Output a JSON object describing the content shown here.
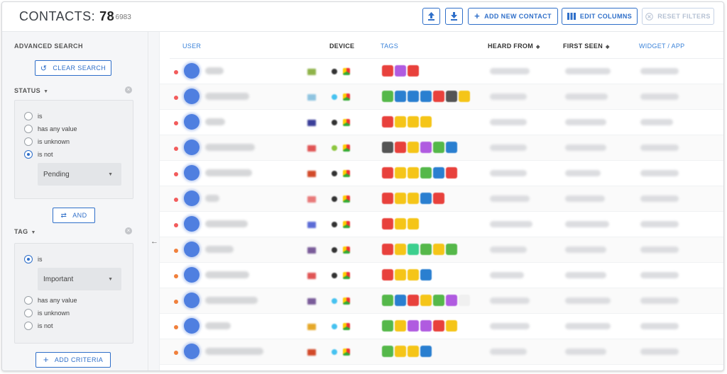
{
  "header": {
    "title": "CONTACTS:",
    "count": "78",
    "total": "/ 6983",
    "upload_icon": "upload-icon",
    "download_icon": "download-icon",
    "add_contact_label": "ADD NEW CONTACT",
    "edit_columns_label": "EDIT COLUMNS",
    "reset_filters_label": "RESET FILTERS",
    "accent_color": "#2f6fc9"
  },
  "sidebar": {
    "heading": "ADVANCED SEARCH",
    "clear_search_label": "CLEAR SEARCH",
    "collapse_icon": "←",
    "status_filter": {
      "label": "STATUS",
      "options": [
        "is",
        "has any value",
        "is unknown",
        "is not"
      ],
      "selected": "is not",
      "value": "Pending"
    },
    "and_label": "AND",
    "tag_filter": {
      "label": "TAG",
      "options": [
        "is",
        "has any value",
        "is unknown",
        "is not"
      ],
      "selected": "is",
      "value": "Important"
    },
    "add_criteria_label": "ADD CRITERIA"
  },
  "table": {
    "columns": {
      "user": "USER",
      "device": "DEVICE",
      "tags": "TAGS",
      "heard_from": "HEARD FROM",
      "first_seen": "FIRST SEEN",
      "widget_app": "WIDGET / APP"
    },
    "rows": [
      {
        "status_color": "#f25c5c",
        "flag_color": "#8fb34a",
        "dev_color": "#333333",
        "tags": [
          "#e8413c",
          "#b05be0",
          "#e8413c"
        ],
        "name_w": 26,
        "heard_w": 56,
        "first_w": 64,
        "widget_w": 54
      },
      {
        "status_color": "#f25c5c",
        "flag_color": "#8fc4e0",
        "dev_color": "#46c2f0",
        "tags": [
          "#55b84a",
          "#2a7fd0",
          "#2a7fd0",
          "#2a7fd0",
          "#e8413c",
          "#555555",
          "#f5c518"
        ],
        "name_w": 62,
        "heard_w": 52,
        "first_w": 60,
        "widget_w": 54
      },
      {
        "status_color": "#f25c5c",
        "flag_color": "#3b3f99",
        "dev_color": "#333333",
        "tags": [
          "#e8413c",
          "#f5c518",
          "#f5c518",
          "#f5c518"
        ],
        "name_w": 28,
        "heard_w": 52,
        "first_w": 58,
        "widget_w": 46
      },
      {
        "status_color": "#f25c5c",
        "flag_color": "#e05555",
        "dev_color": "#8dc63f",
        "tags": [
          "#555555",
          "#e8413c",
          "#f5c518",
          "#b05be0",
          "#55b84a",
          "#2a7fd0"
        ],
        "name_w": 70,
        "heard_w": 52,
        "first_w": 58,
        "widget_w": 54
      },
      {
        "status_color": "#f25c5c",
        "flag_color": "#d24a2a",
        "dev_color": "#333333",
        "tags": [
          "#e8413c",
          "#f5c518",
          "#f5c518",
          "#55b84a",
          "#2a7fd0",
          "#e8413c"
        ],
        "name_w": 66,
        "heard_w": 52,
        "first_w": 50,
        "widget_w": 54
      },
      {
        "status_color": "#f25c5c",
        "flag_color": "#e87a7a",
        "dev_color": "#333333",
        "tags": [
          "#e8413c",
          "#f5c518",
          "#f5c518",
          "#2a7fd0",
          "#e8413c"
        ],
        "name_w": 20,
        "heard_w": 56,
        "first_w": 56,
        "widget_w": 54
      },
      {
        "status_color": "#f25c5c",
        "flag_color": "#5b6bd6",
        "dev_color": "#333333",
        "tags": [
          "#e8413c",
          "#f5c518",
          "#f5c518"
        ],
        "name_w": 60,
        "heard_w": 60,
        "first_w": 62,
        "widget_w": 54
      },
      {
        "status_color": "#f0803c",
        "flag_color": "#7a5c99",
        "dev_color": "#333333",
        "tags": [
          "#e8413c",
          "#f5c518",
          "#3ccf8e",
          "#55b84a",
          "#f5c518",
          "#55b84a"
        ],
        "name_w": 40,
        "heard_w": 52,
        "first_w": 58,
        "widget_w": 54
      },
      {
        "status_color": "#f0803c",
        "flag_color": "#e05555",
        "dev_color": "#333333",
        "tags": [
          "#e8413c",
          "#f5c518",
          "#f5c518",
          "#2a7fd0"
        ],
        "name_w": 62,
        "heard_w": 48,
        "first_w": 58,
        "widget_w": 54
      },
      {
        "status_color": "#f0803c",
        "flag_color": "#7a5c99",
        "dev_color": "#46c2f0",
        "tags": [
          "#55b84a",
          "#2a7fd0",
          "#e8413c",
          "#f5c518",
          "#55b84a",
          "#b05be0",
          "#f0f0f0"
        ],
        "name_w": 74,
        "heard_w": 56,
        "first_w": 64,
        "widget_w": 54
      },
      {
        "status_color": "#f0803c",
        "flag_color": "#e5a82a",
        "dev_color": "#46c2f0",
        "tags": [
          "#55b84a",
          "#f5c518",
          "#b05be0",
          "#b05be0",
          "#e8413c",
          "#f5c518"
        ],
        "name_w": 36,
        "heard_w": 56,
        "first_w": 64,
        "widget_w": 54
      },
      {
        "status_color": "#f0803c",
        "flag_color": "#d24a2a",
        "dev_color": "#46c2f0",
        "tags": [
          "#55b84a",
          "#f5c518",
          "#f5c518",
          "#2a7fd0"
        ],
        "name_w": 82,
        "heard_w": 52,
        "first_w": 58,
        "widget_w": 54
      }
    ]
  }
}
